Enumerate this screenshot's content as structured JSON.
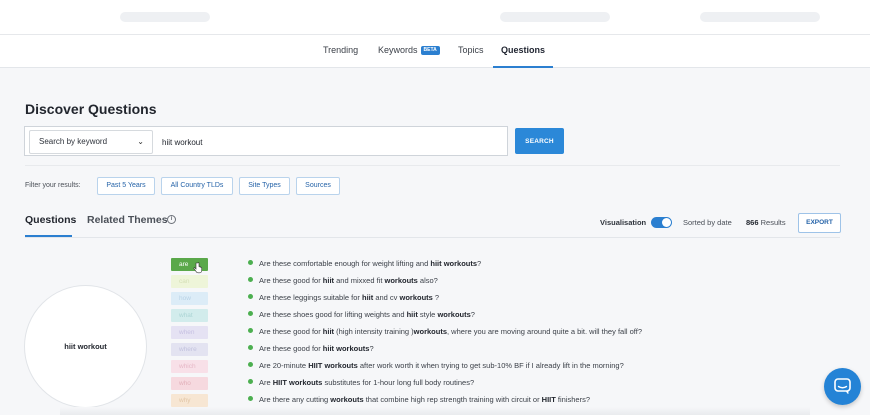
{
  "nav": {
    "items": [
      {
        "label": "Trending"
      },
      {
        "label": "Keywords",
        "badge": "BETA"
      },
      {
        "label": "Topics"
      },
      {
        "label": "Questions",
        "active": true
      }
    ]
  },
  "page_title": "Discover Questions",
  "search": {
    "mode": "Search by keyword",
    "query": "hiit workout",
    "button": "SEARCH"
  },
  "filters": {
    "label": "Filter your results:",
    "buttons": [
      "Past 5 Years",
      "All Country TLDs",
      "Site Types",
      "Sources"
    ]
  },
  "subtabs": {
    "questions": "Questions",
    "related": "Related Themes"
  },
  "toolbar": {
    "visualisation": "Visualisation",
    "visualisation_on": true,
    "sorted": "Sorted by date",
    "results_count": "866",
    "results_label": "Results",
    "export": "EXPORT"
  },
  "viz": {
    "center": "hiit workout",
    "chips": [
      {
        "label": "are",
        "color": "#5aa84a",
        "text_color": "#ffffff"
      },
      {
        "label": "can",
        "color": "#eef5d9",
        "text_color": "#d5dfb6"
      },
      {
        "label": "how",
        "color": "#dcecf7",
        "text_color": "#b8d2e6"
      },
      {
        "label": "what",
        "color": "#d2ecec",
        "text_color": "#acd5d5"
      },
      {
        "label": "when",
        "color": "#e5e2f3",
        "text_color": "#c6c0e2"
      },
      {
        "label": "where",
        "color": "#e3e3f1",
        "text_color": "#c2c2de"
      },
      {
        "label": "which",
        "color": "#f8e0e8",
        "text_color": "#e6b7c6"
      },
      {
        "label": "who",
        "color": "#f6d9df",
        "text_color": "#e2b0ba"
      },
      {
        "label": "why",
        "color": "#f7e6d3",
        "text_color": "#e2c6a6"
      }
    ]
  },
  "questions": [
    {
      "html_parts": [
        [
          "Are these comfortable enough for weight lifting and ",
          false
        ],
        [
          "hiit workouts",
          true
        ],
        [
          "?",
          false
        ]
      ]
    },
    {
      "html_parts": [
        [
          "Are these good for ",
          false
        ],
        [
          "hiit",
          true
        ],
        [
          " and mixxed fit ",
          false
        ],
        [
          "workouts",
          true
        ],
        [
          " also?",
          false
        ]
      ]
    },
    {
      "html_parts": [
        [
          "Are these leggings suitable for ",
          false
        ],
        [
          "hiit",
          true
        ],
        [
          " and cv ",
          false
        ],
        [
          "workouts",
          true
        ],
        [
          " ?",
          false
        ]
      ]
    },
    {
      "html_parts": [
        [
          "Are these shoes good for lifting weights and ",
          false
        ],
        [
          "hiit",
          true
        ],
        [
          " style ",
          false
        ],
        [
          "workouts",
          true
        ],
        [
          "?",
          false
        ]
      ]
    },
    {
      "html_parts": [
        [
          "Are these good for ",
          false
        ],
        [
          "hiit",
          true
        ],
        [
          " (high intensity training )",
          false
        ],
        [
          "workouts",
          true
        ],
        [
          ", where you are moving around quite a bit. will they fall off?",
          false
        ]
      ]
    },
    {
      "html_parts": [
        [
          "Are these good for ",
          false
        ],
        [
          "hiit workouts",
          true
        ],
        [
          "?",
          false
        ]
      ]
    },
    {
      "html_parts": [
        [
          "Are 20-minute ",
          false
        ],
        [
          "HIIT workouts",
          true
        ],
        [
          " after work worth it when trying to get sub-10% BF if I already lift in the morning?",
          false
        ]
      ]
    },
    {
      "html_parts": [
        [
          "Are ",
          false
        ],
        [
          "HIIT workouts",
          true
        ],
        [
          " substitutes for 1-hour long full body routines?",
          false
        ]
      ]
    },
    {
      "html_parts": [
        [
          "Are there any cutting ",
          false
        ],
        [
          "workouts",
          true
        ],
        [
          " that combine high rep strength training with circuit or ",
          false
        ],
        [
          "HIIT",
          true
        ],
        [
          " finishers?",
          false
        ]
      ]
    }
  ]
}
